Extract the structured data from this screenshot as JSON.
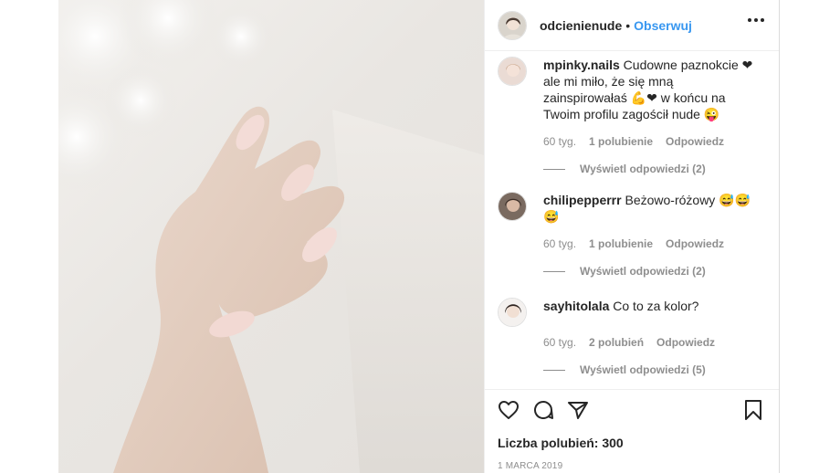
{
  "post": {
    "author": "odcienienude",
    "separator": "•",
    "follow_label": "Obserwuj",
    "more_icon": "more-horizontal-icon"
  },
  "comments": [
    {
      "username": "mpinky.nails",
      "text": "Cudowne paznokcie ❤ ale mi miło, że się mną zainspirowałaś 💪❤ w końcu na Twoim profilu zagościł nude 😜",
      "time": "60 tyg.",
      "likes": "1 polubienie",
      "reply": "Odpowiedz",
      "view_replies": "Wyświetl odpowiedzi (2)"
    },
    {
      "username": "chilipepperrr",
      "text": "Beżowo-różowy 😅😅😅",
      "time": "60 tyg.",
      "likes": "1 polubienie",
      "reply": "Odpowiedz",
      "view_replies": "Wyświetl odpowiedzi (2)"
    },
    {
      "username": "sayhitolala",
      "text": "Co to za kolor?",
      "time": "60 tyg.",
      "likes": "2 polubień",
      "reply": "Odpowiedz",
      "view_replies": "Wyświetl odpowiedzi (5)"
    }
  ],
  "actions": {
    "icons": [
      "heart-icon",
      "comment-icon",
      "share-icon",
      "bookmark-icon"
    ],
    "likes_text": "Liczba polubień: 300",
    "date": "1 MARCA 2019"
  },
  "colors": {
    "accent": "#3897f0",
    "text": "#262626",
    "muted": "#8e8e8e",
    "heart": "#ed1c24"
  }
}
